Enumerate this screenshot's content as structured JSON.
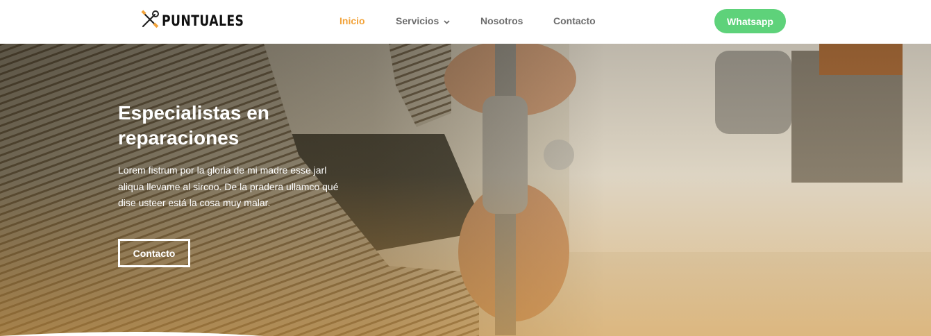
{
  "header": {
    "logo_text": "PUNTUALES",
    "logo_icon": "wrench-screwdriver-icon",
    "nav": [
      {
        "label": "Inicio",
        "active": true
      },
      {
        "label": "Servicios",
        "has_dropdown": true
      },
      {
        "label": "Nosotros"
      },
      {
        "label": "Contacto"
      }
    ],
    "whatsapp_label": "Whatsapp"
  },
  "hero": {
    "title": "Especialistas en reparaciones",
    "description": "Lorem fistrum por la gloria de mi madre esse jarl aliqua llevame al sircoo. De la pradera ullamco qué dise usteer está la cosa muy malar.",
    "cta_label": "Contacto"
  },
  "colors": {
    "accent_active": "#f2a33a",
    "whatsapp_green": "#5ed27a",
    "nav_text": "#6d6d6d"
  }
}
